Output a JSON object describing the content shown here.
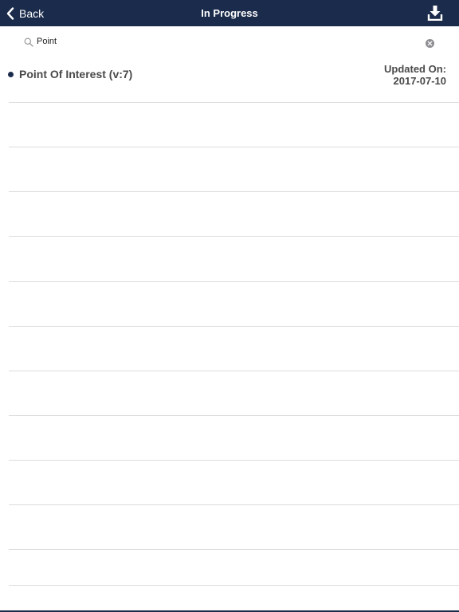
{
  "header": {
    "back_label": "Back",
    "title": "In Progress",
    "back_icon": "chevron-left-icon",
    "download_icon": "download-icon",
    "background_color": "#1b2b4b"
  },
  "search": {
    "value": "Point",
    "icon": "search-icon",
    "clear_icon": "clear-circle-icon"
  },
  "results": [
    {
      "title": "Point Of Interest (v:7)",
      "updated_label": "Updated On:",
      "updated_date": "2017-07-10"
    }
  ]
}
